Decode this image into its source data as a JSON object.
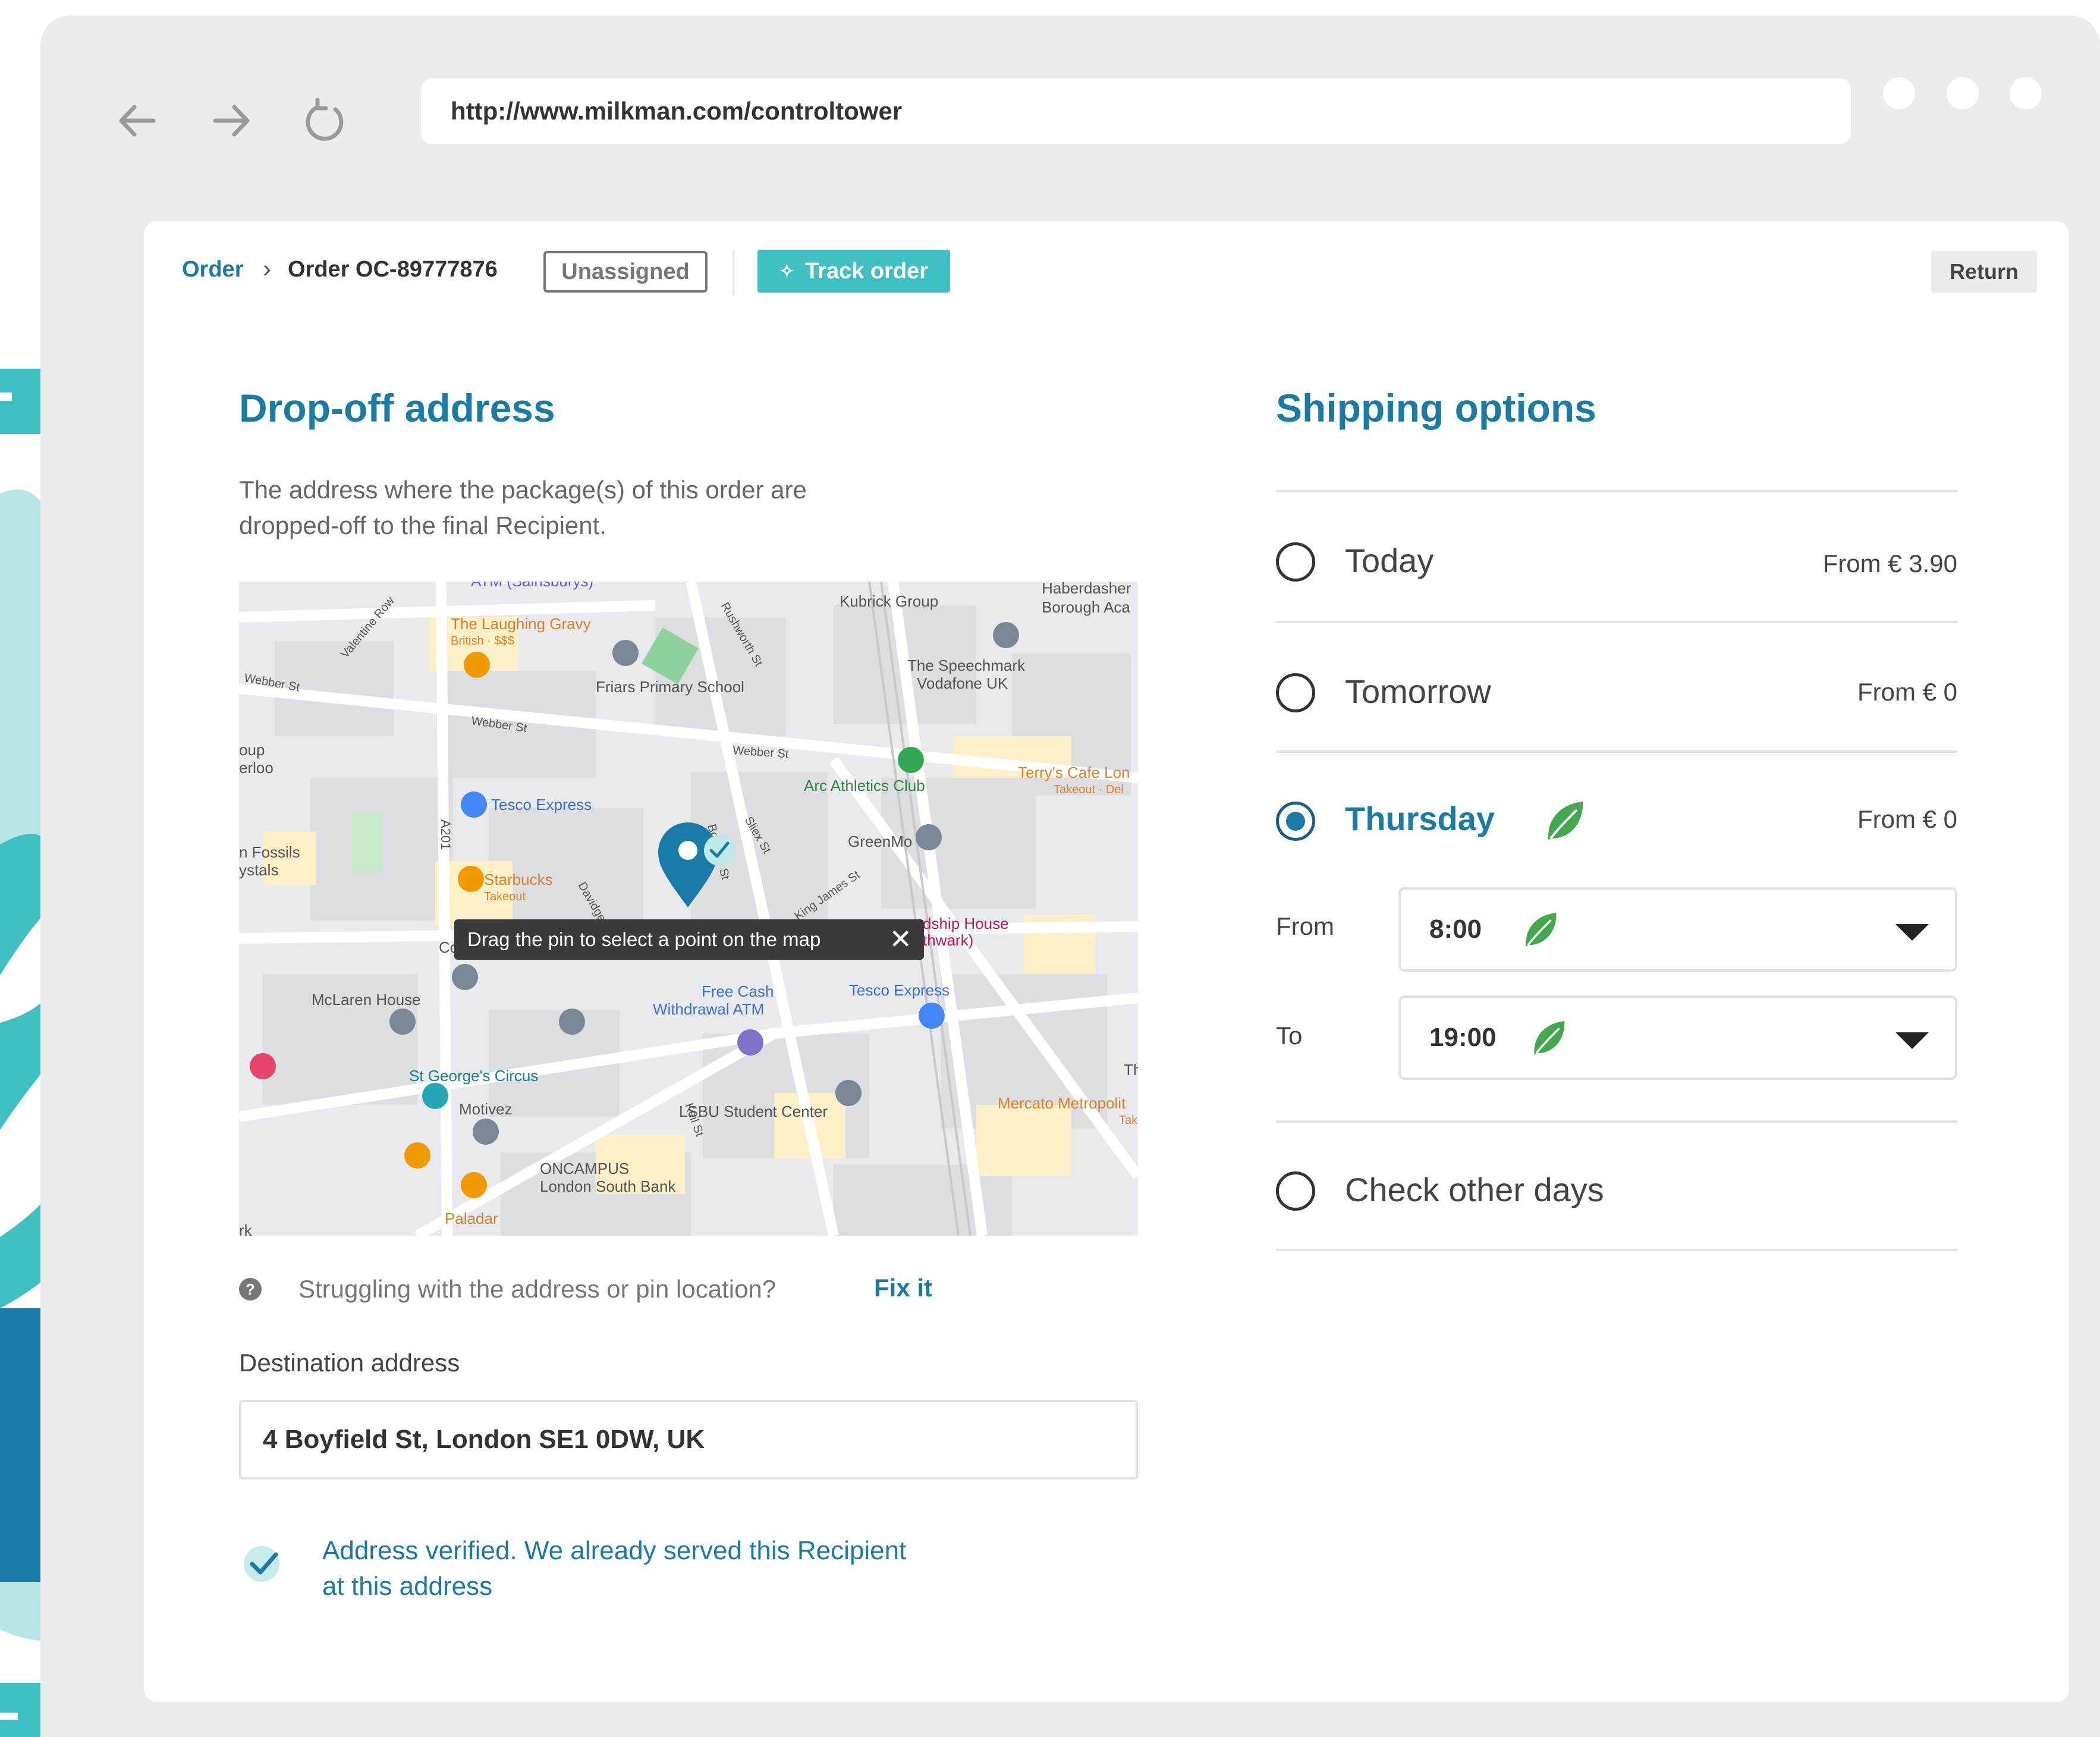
{
  "browser": {
    "url": "http://www.milkman.com/controltower"
  },
  "breadcrumb": {
    "root": "Order",
    "separator": "›",
    "current": "Order OC-89777876"
  },
  "status_badge": "Unassigned",
  "track_button": {
    "label": "Track order",
    "icon": "crosshair-icon"
  },
  "return_button": "Return",
  "dropoff": {
    "title": "Drop-off address",
    "description": "The address where the package(s) of this order are dropped-off to the final Recipient.",
    "map": {
      "tooltip": "Drag the pin to select a point on the map",
      "labels": [
        "ATM (Sainsburys)",
        "Haberdasher",
        "Borough Aca",
        "Kubrick Group",
        "The Laughing Gravy",
        "British · $$$",
        "Friars Primary School",
        "The Speechmark",
        "Vodafone UK",
        "Webber St",
        "Webber St",
        "Webber St",
        "oup",
        "erloo",
        "Arc Athletics Club",
        "Terry's Cafe Lon",
        "Takeout · Del",
        "Tesco Express",
        "A201",
        "n Fossils",
        "ystals",
        "GreenMo",
        "Starbucks",
        "Takeout",
        "Davidge",
        "Co",
        "dship House",
        "thwark)",
        "Tesco Express",
        "Free Cash",
        "Withdrawal ATM",
        "McLaren House",
        "St George's Circus",
        "LSBU Student Center",
        "Motivez",
        "Mercato Metropolit",
        "Tak",
        "ONCAMPUS",
        "London South Bank",
        "Paladar",
        "Rushworth St",
        "Valentine Row",
        "Sliex St",
        "King James St",
        "Keil St",
        "Boyfield St",
        "Th",
        "rk"
      ]
    },
    "help_text": "Struggling with the address or pin location?",
    "fix_link": "Fix it",
    "destination_label": "Destination address",
    "destination_value": "4 Boyfield St, London SE1 0DW, UK",
    "verified_text": "Address verified. We already served this Recipient at this address"
  },
  "shipping": {
    "title": "Shipping options",
    "options": [
      {
        "label": "Today",
        "price": "From € 3.90",
        "selected": false
      },
      {
        "label": "Tomorrow",
        "price": "From € 0",
        "selected": false
      },
      {
        "label": "Thursday",
        "price": "From € 0",
        "selected": true,
        "eco": true
      },
      {
        "label": "Check other days",
        "price": "",
        "selected": false
      }
    ],
    "from_label": "From",
    "from_value": "8:00",
    "to_label": "To",
    "to_value": "19:00"
  },
  "colors": {
    "brand": "#1a7ba6",
    "accent": "#3fbfc2",
    "leaf": "#3aa64a",
    "frame": "#ececec"
  }
}
